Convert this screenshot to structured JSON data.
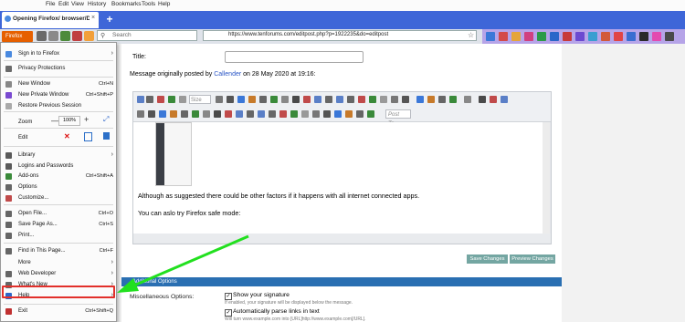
{
  "menubar": {
    "file": "File",
    "edit": "Edit",
    "view": "View",
    "history": "History",
    "bookmarks": "Bookmarks",
    "tools": "Tools",
    "help": "Help"
  },
  "tab": {
    "title": "Opening Firefox/ browser/Discord"
  },
  "nav": {
    "firefox_button": "Firefox",
    "search_placeholder": "Search",
    "url": "https://www.tenforums.com/editpost.php?p=1922235&do=editpost"
  },
  "menu": {
    "items": [
      {
        "label": "Sign in to Firefox",
        "shortcut": "",
        "arrow": "›"
      },
      {
        "label": "Privacy Protections",
        "shortcut": ""
      },
      {
        "label": "New Window",
        "shortcut": "Ctrl+N"
      },
      {
        "label": "New Private Window",
        "shortcut": "Ctrl+Shift+P"
      },
      {
        "label": "Restore Previous Session",
        "shortcut": ""
      },
      {
        "label": "Zoom",
        "shortcut": ""
      },
      {
        "label": "Edit",
        "shortcut": ""
      },
      {
        "label": "Library",
        "shortcut": "",
        "arrow": "›"
      },
      {
        "label": "Logins and Passwords",
        "shortcut": ""
      },
      {
        "label": "Add-ons",
        "shortcut": "Ctrl+Shift+A"
      },
      {
        "label": "Options",
        "shortcut": ""
      },
      {
        "label": "Customize...",
        "shortcut": ""
      },
      {
        "label": "Open File...",
        "shortcut": "Ctrl+O"
      },
      {
        "label": "Save Page As...",
        "shortcut": "Ctrl+S"
      },
      {
        "label": "Print...",
        "shortcut": ""
      },
      {
        "label": "Find in This Page...",
        "shortcut": "Ctrl+F"
      },
      {
        "label": "More",
        "shortcut": "",
        "arrow": "›"
      },
      {
        "label": "Web Developer",
        "shortcut": "",
        "arrow": "›"
      },
      {
        "label": "What's New",
        "shortcut": "",
        "arrow": "›"
      },
      {
        "label": "Help",
        "shortcut": "",
        "arrow": "›"
      },
      {
        "label": "Exit",
        "shortcut": "Ctrl+Shift+Q"
      }
    ],
    "zoom": {
      "minus": "—",
      "value": "100%",
      "plus": "+",
      "fullscreen": "⤢"
    },
    "edit_cut": "✕"
  },
  "page": {
    "title_label": "Title:",
    "quote_prefix": "Message originally posted by ",
    "quote_user": "Callender",
    "quote_suffix": " on 28 May 2020 at 19:16:",
    "size_select": "Size",
    "post_to_select": "Post To...",
    "body_line1": "Although as suggested there could be other factors if it happens with all internet connected apps.",
    "body_line2": "You can aslo try Firefox safe mode:",
    "save_changes": "Save Changes",
    "preview_changes": "Preview Changes",
    "options_header": "Additional Options",
    "misc_label": "Miscellaneous Options:",
    "option1_label": "Show your signature",
    "option1_desc": "If enabled, your signature will be displayed below the message.",
    "option2_label": "Automatically parse links in text",
    "option2_desc": "Will turn www.example.com into [URL]http://www.example.com[/URL].",
    "checkmark": "✓"
  },
  "colors": {
    "tab_strip": "#3e66d8",
    "firefox_orange": "#e66000",
    "highlight_red": "#e2302b",
    "arrow_green": "#22e01f",
    "toolbar_lavender": "#b6a4e8",
    "button_teal": "#74a6a2"
  }
}
